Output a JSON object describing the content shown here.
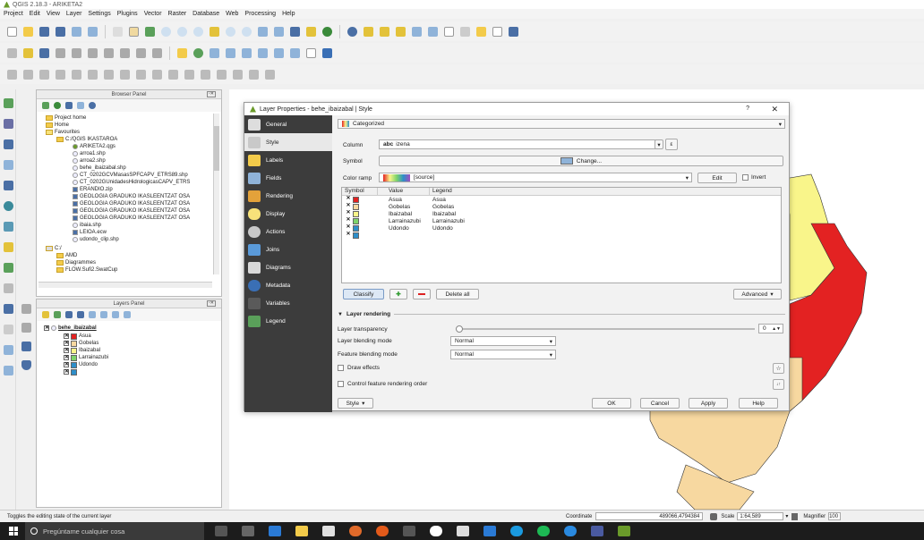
{
  "window": {
    "title": "QGIS 2.18.3 - ARIKETA2"
  },
  "menu": [
    "Project",
    "Edit",
    "View",
    "Layer",
    "Settings",
    "Plugins",
    "Vector",
    "Raster",
    "Database",
    "Web",
    "Processing",
    "Help"
  ],
  "browser": {
    "title": "Browser Panel",
    "items": [
      "Project home",
      "Home",
      "Favourites",
      "C:/QGIS IKASTAROA",
      "ARIKETA2.qgs",
      "arroa1.shp",
      "arroa2.shp",
      "behe_ibaizabal.shp",
      "CT_0202GCVMasasSPFCAPV_ETRS89.shp",
      "CT_0202GUnidadesHidrologicasCAPV_ETRS",
      "ERANDIO.zip",
      "GEOLOGIA GRADUKO IKASLEENTZAT OSA",
      "GEOLOGIA GRADUKO IKASLEENTZAT OSA",
      "GEOLOGIA GRADUKO IKASLEENTZAT OSA",
      "GEOLOGIA GRADUKO IKASLEENTZAT OSA",
      "ibaia.shp",
      "LEIOA.ecw",
      "udondo_clip.shp",
      "C:/",
      "AMD",
      "Diagrammes",
      "FLOW.Sufi2.SwatCup"
    ]
  },
  "layers": {
    "title": "Layers Panel",
    "layer_name": "behe_ibaizabal",
    "classes": [
      {
        "label": "Asua",
        "color": "#e32222"
      },
      {
        "label": "Gobelas",
        "color": "#f7d8a0"
      },
      {
        "label": "Ibaizabal",
        "color": "#f9f58a"
      },
      {
        "label": "Larrainazubi",
        "color": "#7ed36b"
      },
      {
        "label": "Udondo",
        "color": "#2e8ec9"
      }
    ]
  },
  "dialog": {
    "title": "Layer Properties - behe_ibaizabal | Style",
    "help_mark": "?",
    "close_mark": "✕",
    "tabs": [
      "General",
      "Style",
      "Labels",
      "Fields",
      "Rendering",
      "Display",
      "Actions",
      "Joins",
      "Diagrams",
      "Metadata",
      "Variables",
      "Legend"
    ],
    "renderer": "Categorized",
    "column_label": "Column",
    "column_value": "izena",
    "column_type": "abc",
    "epsilon": "ε",
    "symbol_label": "Symbol",
    "change_label": "Change...",
    "ramp_label": "Color ramp",
    "ramp_value": "[source]",
    "edit_label": "Edit",
    "invert_label": "Invert",
    "table_headers": [
      "Symbol",
      "Value",
      "Legend"
    ],
    "rows": [
      {
        "value": "Asua",
        "legend": "Asua",
        "color": "#e32222"
      },
      {
        "value": "Gobelas",
        "legend": "Gobelas",
        "color": "#f7d8a0"
      },
      {
        "value": "Ibaizabal",
        "legend": "Ibaizabal",
        "color": "#f9f58a"
      },
      {
        "value": "Larrainazubi",
        "legend": "Larrainazubi",
        "color": "#7ed36b"
      },
      {
        "value": "Udondo",
        "legend": "Udondo",
        "color": "#2e8ec9"
      }
    ],
    "classify_label": "Classify",
    "delete_all_label": "Delete all",
    "advanced_label": "Advanced",
    "rendering_header": "Layer rendering",
    "transparency_label": "Layer transparency",
    "transparency_value": "0",
    "blending_label": "Layer blending mode",
    "blending_value": "Normal",
    "feature_blending_label": "Feature blending mode",
    "feature_blending_value": "Normal",
    "draw_effects_label": "Draw effects",
    "control_order_label": "Control feature rendering order",
    "style_label": "Style",
    "ok_label": "OK",
    "cancel_label": "Cancel",
    "apply_label": "Apply",
    "help_label": "Help"
  },
  "status": {
    "message": "Toggles the editing state of the current layer",
    "coordinate_label": "Coordinate",
    "coordinate_value": "489066,4794384",
    "scale_label": "Scale",
    "scale_value": "1:64,589",
    "magnifier_label": "Magnifier",
    "magnifier_value": "100"
  },
  "taskbar": {
    "search_placeholder": "Pregúntame cualquier cosa"
  }
}
